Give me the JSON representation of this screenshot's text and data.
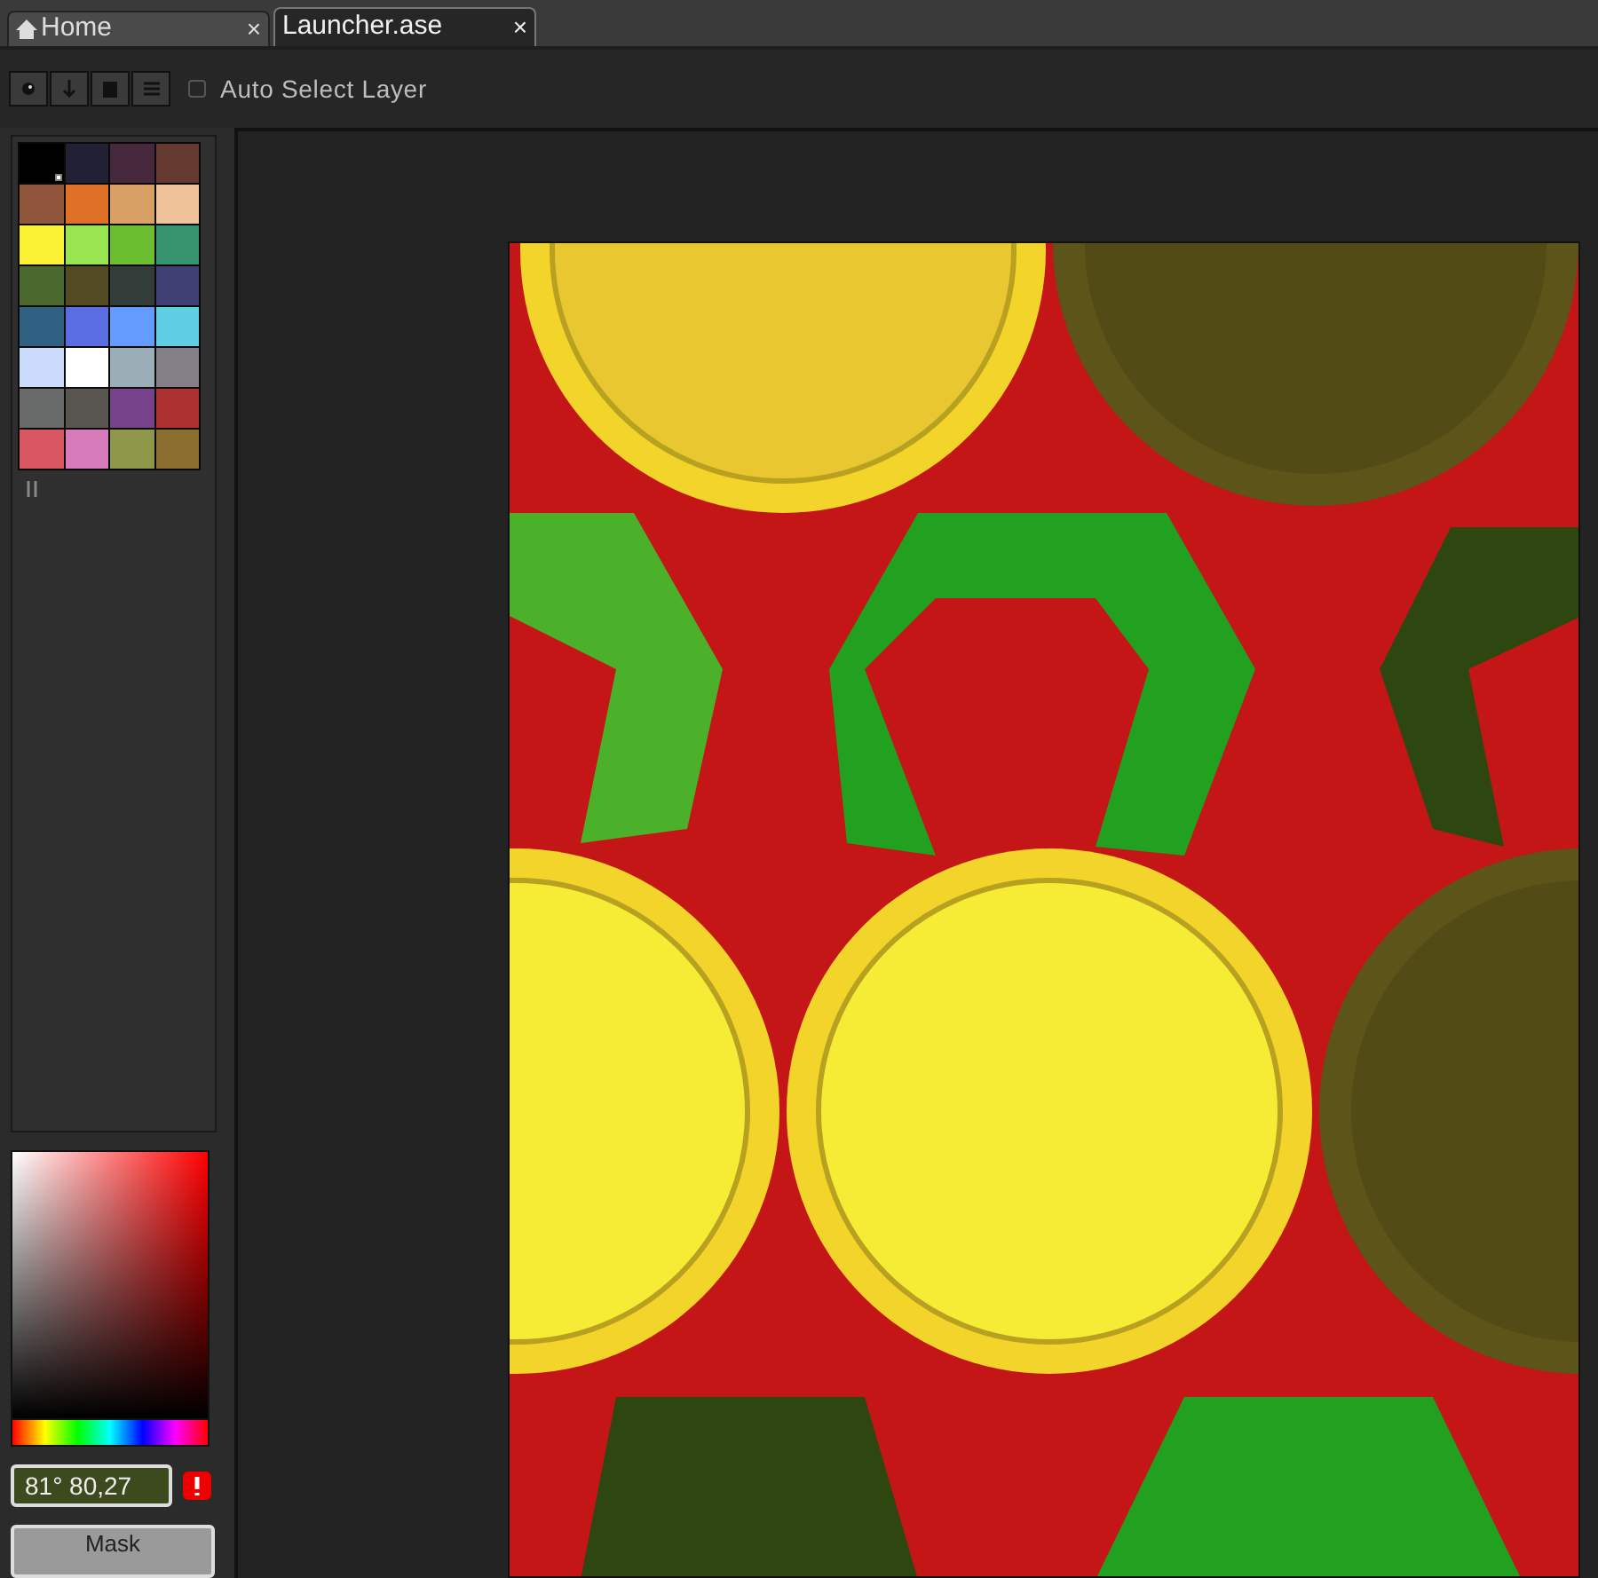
{
  "tabs": [
    {
      "label": "Home",
      "selected": false,
      "close": "×"
    },
    {
      "label": "Launcher.ase",
      "selected": true,
      "close": "×"
    }
  ],
  "toolbar": {
    "auto_select_layer": {
      "label": "Auto Select Layer",
      "checked": false
    }
  },
  "palette": [
    {
      "color": "#000000",
      "selected": true
    },
    {
      "color": "#222034",
      "selected": false
    },
    {
      "color": "#45283c",
      "selected": false
    },
    {
      "color": "#663931",
      "selected": false
    },
    {
      "color": "#8f563b",
      "selected": false
    },
    {
      "color": "#df7126",
      "selected": false
    },
    {
      "color": "#d9a066",
      "selected": false
    },
    {
      "color": "#eec39a",
      "selected": false
    },
    {
      "color": "#fbf236",
      "selected": false
    },
    {
      "color": "#99e550",
      "selected": false
    },
    {
      "color": "#6abe30",
      "selected": false
    },
    {
      "color": "#37946e",
      "selected": false
    },
    {
      "color": "#4b692f",
      "selected": false
    },
    {
      "color": "#524b24",
      "selected": false
    },
    {
      "color": "#323c39",
      "selected": false
    },
    {
      "color": "#3f3f74",
      "selected": false
    },
    {
      "color": "#306082",
      "selected": false
    },
    {
      "color": "#5b6ee1",
      "selected": false
    },
    {
      "color": "#639bff",
      "selected": false
    },
    {
      "color": "#5fcde4",
      "selected": false
    },
    {
      "color": "#cbdbfc",
      "selected": false
    },
    {
      "color": "#ffffff",
      "selected": false
    },
    {
      "color": "#9badb7",
      "selected": false
    },
    {
      "color": "#847e87",
      "selected": false
    },
    {
      "color": "#696a6a",
      "selected": false
    },
    {
      "color": "#595652",
      "selected": false
    },
    {
      "color": "#76428a",
      "selected": false
    },
    {
      "color": "#ac3232",
      "selected": false
    },
    {
      "color": "#d95763",
      "selected": false
    },
    {
      "color": "#d77bba",
      "selected": false
    },
    {
      "color": "#8f974a",
      "selected": false
    },
    {
      "color": "#8a6f30",
      "selected": false
    }
  ],
  "color_field": {
    "value": "81° 80,27"
  },
  "mask_button": {
    "label": "Mask"
  }
}
